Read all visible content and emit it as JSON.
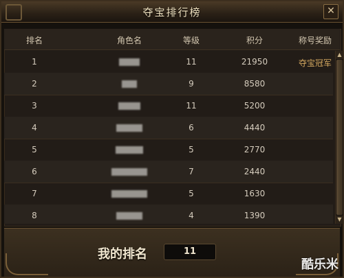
{
  "window": {
    "title": "夺宝排行榜"
  },
  "columns": {
    "rank": "排名",
    "name": "角色名",
    "level": "等级",
    "score": "积分",
    "award": "称号奖励"
  },
  "rows": [
    {
      "rank": "1",
      "level": "11",
      "score": "21950",
      "award": "夺宝冠军"
    },
    {
      "rank": "2",
      "level": "9",
      "score": "8580",
      "award": ""
    },
    {
      "rank": "3",
      "level": "11",
      "score": "5200",
      "award": ""
    },
    {
      "rank": "4",
      "level": "6",
      "score": "4440",
      "award": ""
    },
    {
      "rank": "5",
      "level": "5",
      "score": "2770",
      "award": ""
    },
    {
      "rank": "6",
      "level": "7",
      "score": "2440",
      "award": ""
    },
    {
      "rank": "7",
      "level": "5",
      "score": "1630",
      "award": ""
    },
    {
      "rank": "8",
      "level": "4",
      "score": "1390",
      "award": ""
    }
  ],
  "footer": {
    "my_rank_label": "我的排名",
    "my_rank_value": "11"
  },
  "watermark": "酷乐米",
  "icons": {
    "close": "close-icon",
    "scroll_up": "scroll-up-icon",
    "scroll_down": "scroll-down-icon"
  }
}
